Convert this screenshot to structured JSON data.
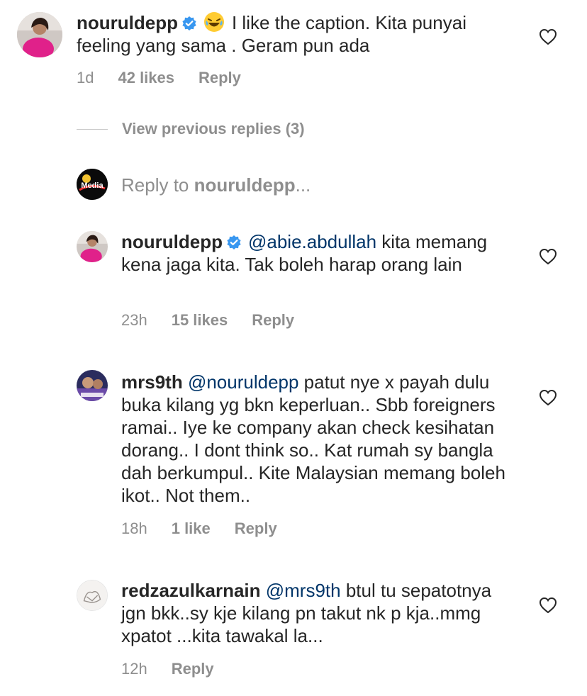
{
  "main_comment": {
    "username": "nouruldepp",
    "text": "I like the caption. Kita punyai feeling yang sama . Geram pun ada",
    "time": "1d",
    "likes": "42 likes",
    "reply": "Reply"
  },
  "view_previous": {
    "label": "View previous replies (3)"
  },
  "reply_input": {
    "prefix": "Reply to ",
    "target": "nouruldepp",
    "suffix": "..."
  },
  "replies": [
    {
      "username": "nouruldepp",
      "mention": "@abie.abdullah",
      "text": " kita memang kena jaga kita. Tak boleh harap orang lain",
      "time": "23h",
      "likes": "15 likes",
      "reply": "Reply"
    },
    {
      "username": "mrs9th",
      "mention": "@nouruldepp",
      "text": " patut nye x payah dulu buka kilang yg bkn keperluan.. Sbb foreigners ramai.. Iye ke company akan check kesihatan dorang.. I dont think so.. Kat rumah sy bangla dah berkumpul.. Kite Malaysian memang boleh ikot.. Not them..",
      "time": "18h",
      "likes": "1 like",
      "reply": "Reply"
    },
    {
      "username": "redzazulkarnain",
      "mention": "@mrs9th",
      "text": " btul tu sepatotnya jgn bkk..sy kje kilang pn takut nk p kja..mmg xpatot ...kita tawakal la...",
      "time": "12h",
      "reply": "Reply"
    }
  ],
  "colors": {
    "text": "#262626",
    "muted": "#8e8e8e",
    "mention": "#003569",
    "verified": "#3897f0"
  },
  "icons": [
    "heart-icon",
    "verified-badge-icon",
    "laughing-emoji-icon"
  ],
  "media_logo_text": "Media"
}
